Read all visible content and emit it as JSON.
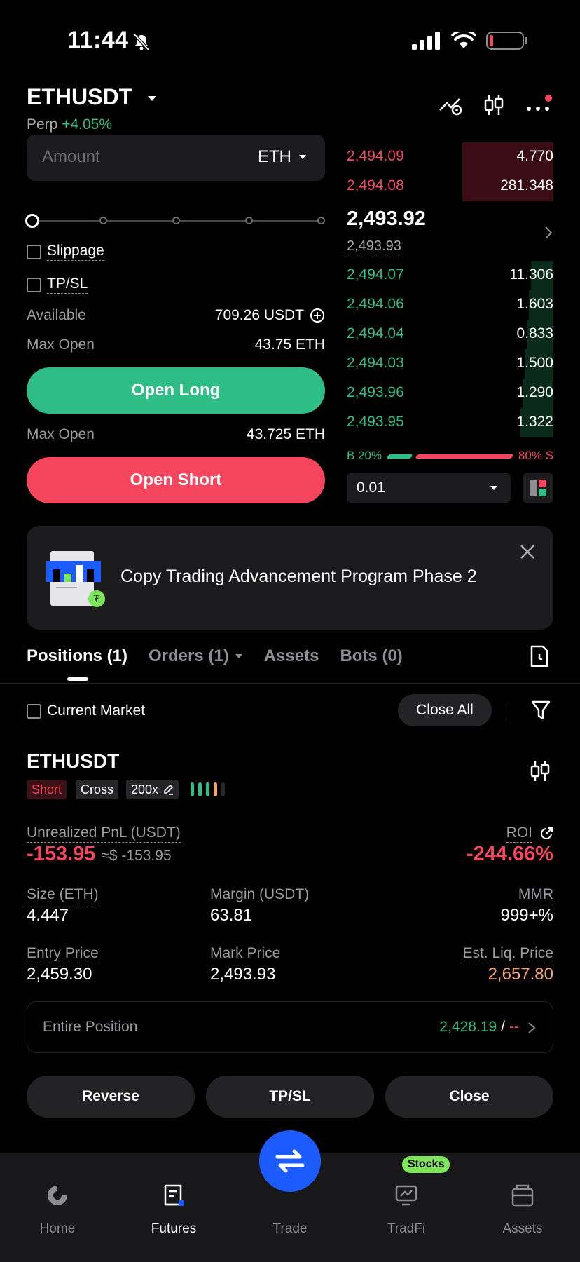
{
  "status_bar": {
    "time": "11:44"
  },
  "header": {
    "symbol": "ETHUSDT",
    "perp_label": "Perp",
    "change": "+4.05%"
  },
  "order_form": {
    "amount_placeholder": "Amount",
    "amount_unit": "ETH",
    "slippage_label": "Slippage",
    "tpsl_label": "TP/SL",
    "available_label": "Available",
    "available_value": "709.26 USDT",
    "long_max_open_label": "Max Open",
    "long_max_open_value": "43.75 ETH",
    "open_long_label": "Open Long",
    "short_max_open_label": "Max Open",
    "short_max_open_value": "43.725 ETH",
    "open_short_label": "Open Short"
  },
  "order_book": {
    "asks": [
      {
        "price": "2,494.09",
        "qty": "4.770",
        "depth": 0.44
      },
      {
        "price": "2,494.08",
        "qty": "281.348",
        "depth": 0.44
      }
    ],
    "last_price": "2,493.92",
    "mark_price": "2,493.93",
    "bids": [
      {
        "price": "2,494.07",
        "qty": "11.306",
        "depth": 0.11
      },
      {
        "price": "2,494.06",
        "qty": "1.603",
        "depth": 0.12
      },
      {
        "price": "2,494.04",
        "qty": "0.833",
        "depth": 0.13
      },
      {
        "price": "2,494.03",
        "qty": "1.500",
        "depth": 0.14
      },
      {
        "price": "2,493.96",
        "qty": "1.290",
        "depth": 0.15
      },
      {
        "price": "2,493.95",
        "qty": "1.322",
        "depth": 0.16
      }
    ],
    "buy_ratio": "B 20%",
    "sell_ratio": "80% S",
    "buy_fraction": 0.2,
    "depth_value": "0.01"
  },
  "banner": {
    "text": "Copy Trading Advancement Program Phase 2"
  },
  "tabs": {
    "positions": "Positions (1)",
    "orders": "Orders (1)",
    "assets": "Assets",
    "bots": "Bots (0)"
  },
  "positions_bar": {
    "current_market_label": "Current Market",
    "close_all_label": "Close All"
  },
  "position": {
    "symbol": "ETHUSDT",
    "side": "Short",
    "margin_mode": "Cross",
    "leverage": "200x",
    "pnl_label": "Unrealized PnL (USDT)",
    "pnl_value": "-153.95",
    "pnl_usd": "≈$ -153.95",
    "roi_label": "ROI",
    "roi_value": "-244.66%",
    "size_label": "Size (ETH)",
    "size_value": "4.447",
    "margin_label": "Margin (USDT)",
    "margin_value": "63.81",
    "mmr_label": "MMR",
    "mmr_value": "999+%",
    "entry_label": "Entry Price",
    "entry_value": "2,459.30",
    "mark_label": "Mark Price",
    "mark_value": "2,493.93",
    "liq_label": "Est. Liq. Price",
    "liq_value": "2,657.80",
    "entire_label": "Entire Position",
    "tp_value": "2,428.19",
    "sl_separator": "/",
    "sl_value": "--",
    "reverse_label": "Reverse",
    "tpsl_label": "TP/SL",
    "close_label": "Close"
  },
  "bottom_nav": {
    "home": "Home",
    "futures": "Futures",
    "trade": "Trade",
    "tradfi": "TradFi",
    "stocks_badge": "Stocks",
    "assets": "Assets"
  },
  "colors": {
    "green": "#2ebd85",
    "red": "#f6465d",
    "orange": "#f5a56b",
    "blue": "#1c5cff"
  }
}
